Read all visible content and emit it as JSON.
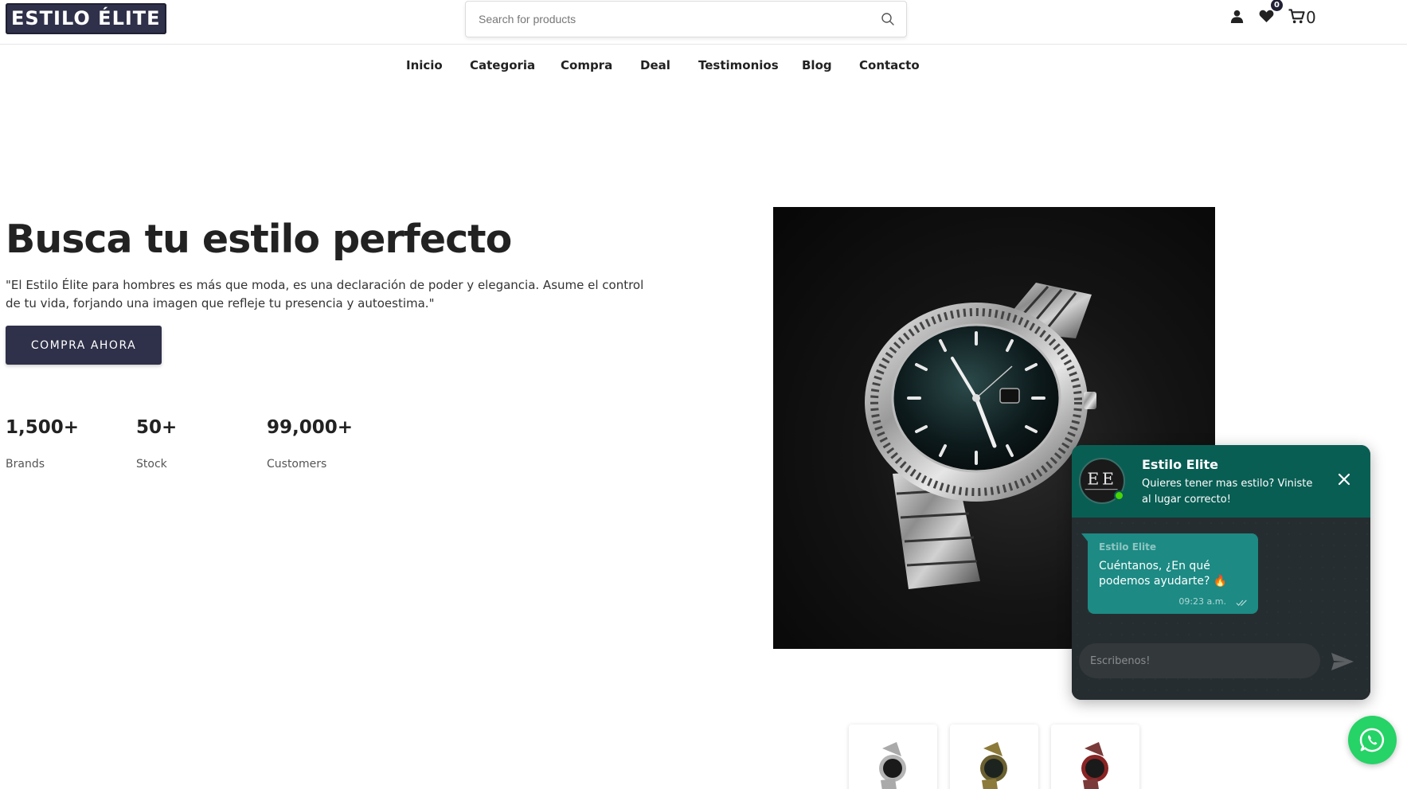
{
  "header": {
    "logo_text": "ESTILO ÉLITE",
    "search_placeholder": "Search for products",
    "wishlist_count": "0",
    "cart_count": "0"
  },
  "nav": {
    "items": [
      {
        "label": "Inicio"
      },
      {
        "label": "Categoria"
      },
      {
        "label": "Compra"
      },
      {
        "label": "Deal"
      },
      {
        "label": "Testimonios"
      },
      {
        "label": "Blog"
      },
      {
        "label": "Contacto"
      }
    ]
  },
  "hero": {
    "title": "Busca tu estilo perfecto",
    "description": "\"El Estilo Élite para hombres es más que moda, es una declaración de poder y elegancia. Asume el control de tu vida, forjando una imagen que refleje tu presencia y autoestima.\"",
    "cta_label": "COMPRA AHORA",
    "stats": [
      {
        "value": "1,500+",
        "label": "Brands"
      },
      {
        "value": "50+",
        "label": "Stock"
      },
      {
        "value": "99,000+",
        "label": "Customers"
      }
    ]
  },
  "chat_widget": {
    "name": "Estilo Elite",
    "subtitle": "Quieres tener mas estilo? Viniste al lugar correcto!",
    "message_author": "Estilo Elite",
    "message_text": "Cuéntanos, ¿En qué podemos ayudarte? 🔥",
    "message_time": "09:23 a.m.",
    "input_placeholder": "Escribenos!"
  },
  "colors": {
    "brand": "#2f3049",
    "chat_header": "#095e54",
    "chat_bubble": "#1d8a84",
    "whatsapp": "#25d366"
  },
  "icons": [
    "search-icon",
    "user-icon",
    "heart-icon",
    "cart-icon",
    "close-icon",
    "send-icon",
    "whatsapp-icon",
    "read-check-icon"
  ]
}
